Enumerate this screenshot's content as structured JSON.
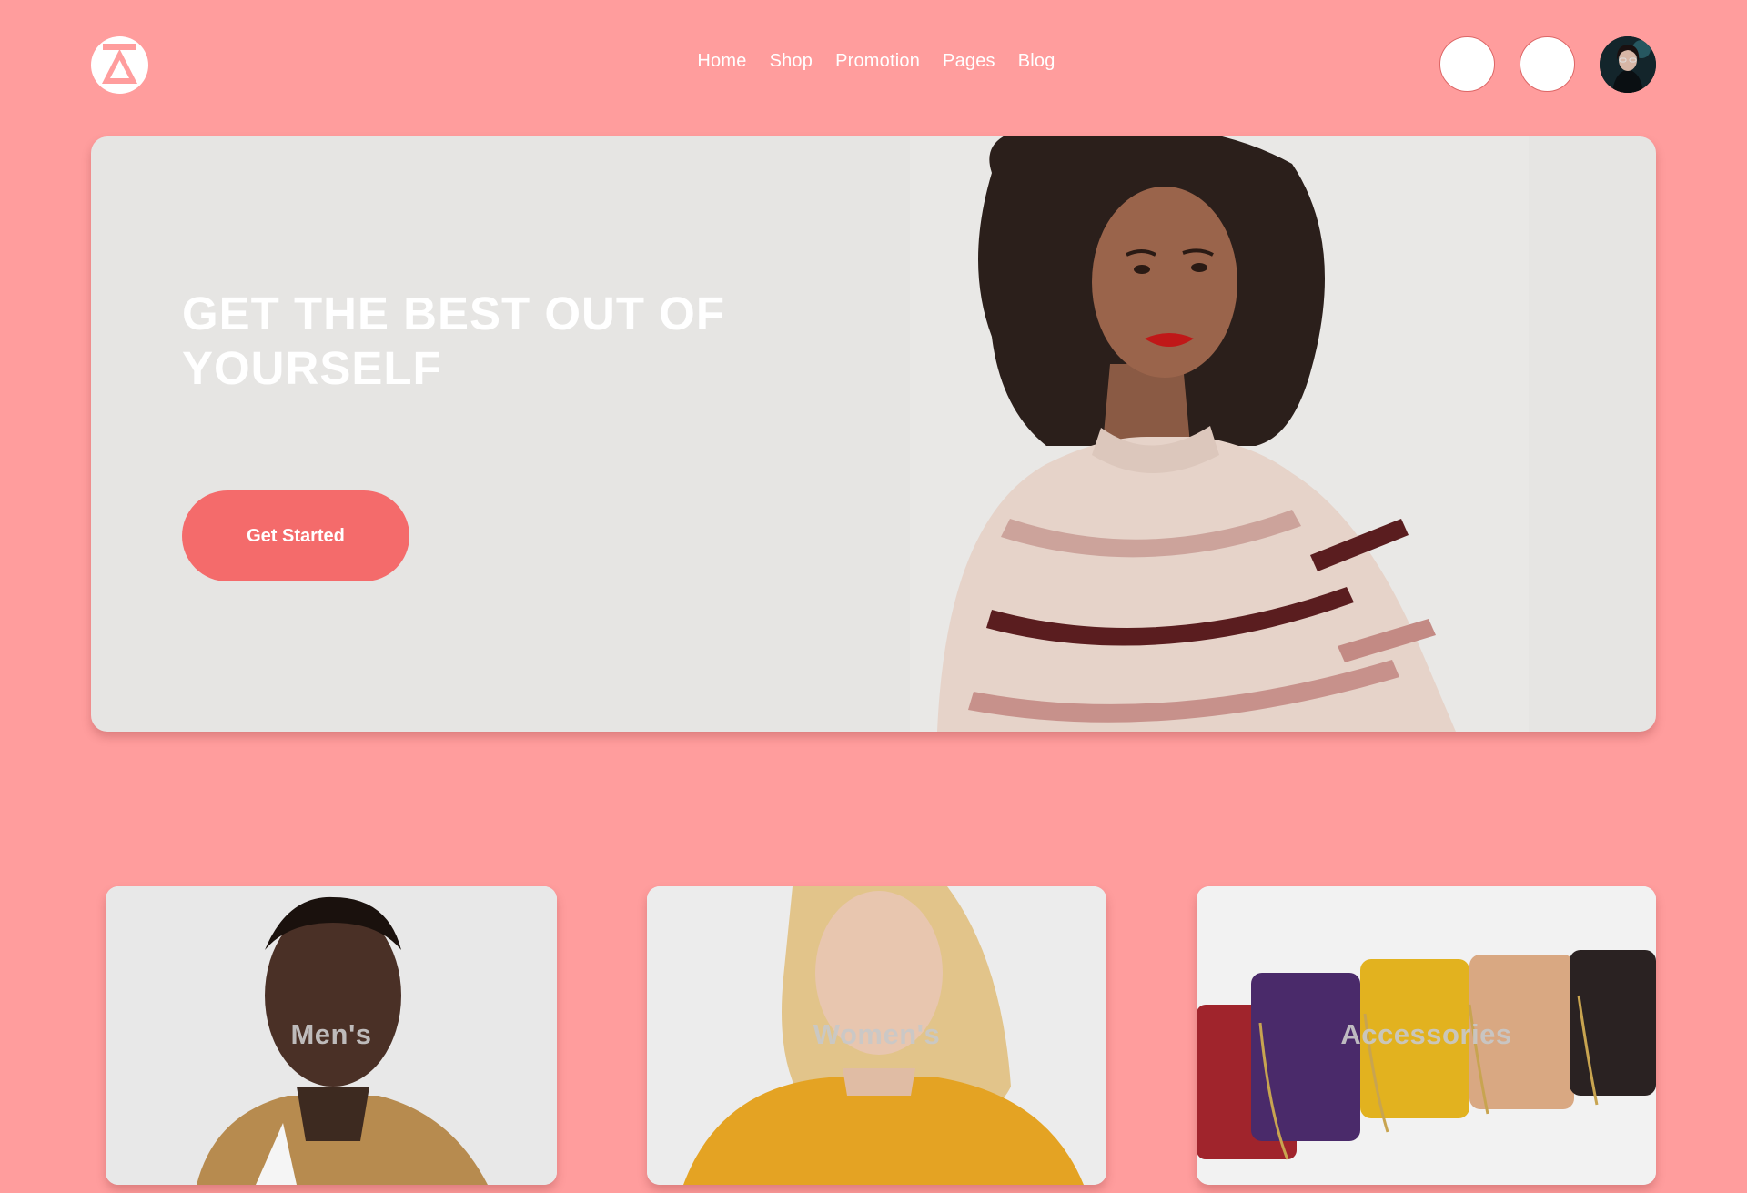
{
  "nav": {
    "items": [
      {
        "label": "Home"
      },
      {
        "label": "Shop"
      },
      {
        "label": "Promotion"
      },
      {
        "label": "Pages"
      },
      {
        "label": "Blog"
      }
    ]
  },
  "header": {
    "logo_icon": "brand-logo-icon",
    "action_buttons": [
      "search-icon",
      "cart-icon"
    ],
    "avatar_icon": "user-avatar"
  },
  "hero": {
    "title": "GET THE BEST OUT OF YOURSELF",
    "cta_label": "Get Started"
  },
  "categories": [
    {
      "label": "Men's"
    },
    {
      "label": "Women's"
    },
    {
      "label": "Accessories"
    }
  ],
  "colors": {
    "background": "#ff9d9d",
    "accent": "#f46b6b",
    "hero_bg": "#e6e5e3",
    "white": "#ffffff"
  }
}
